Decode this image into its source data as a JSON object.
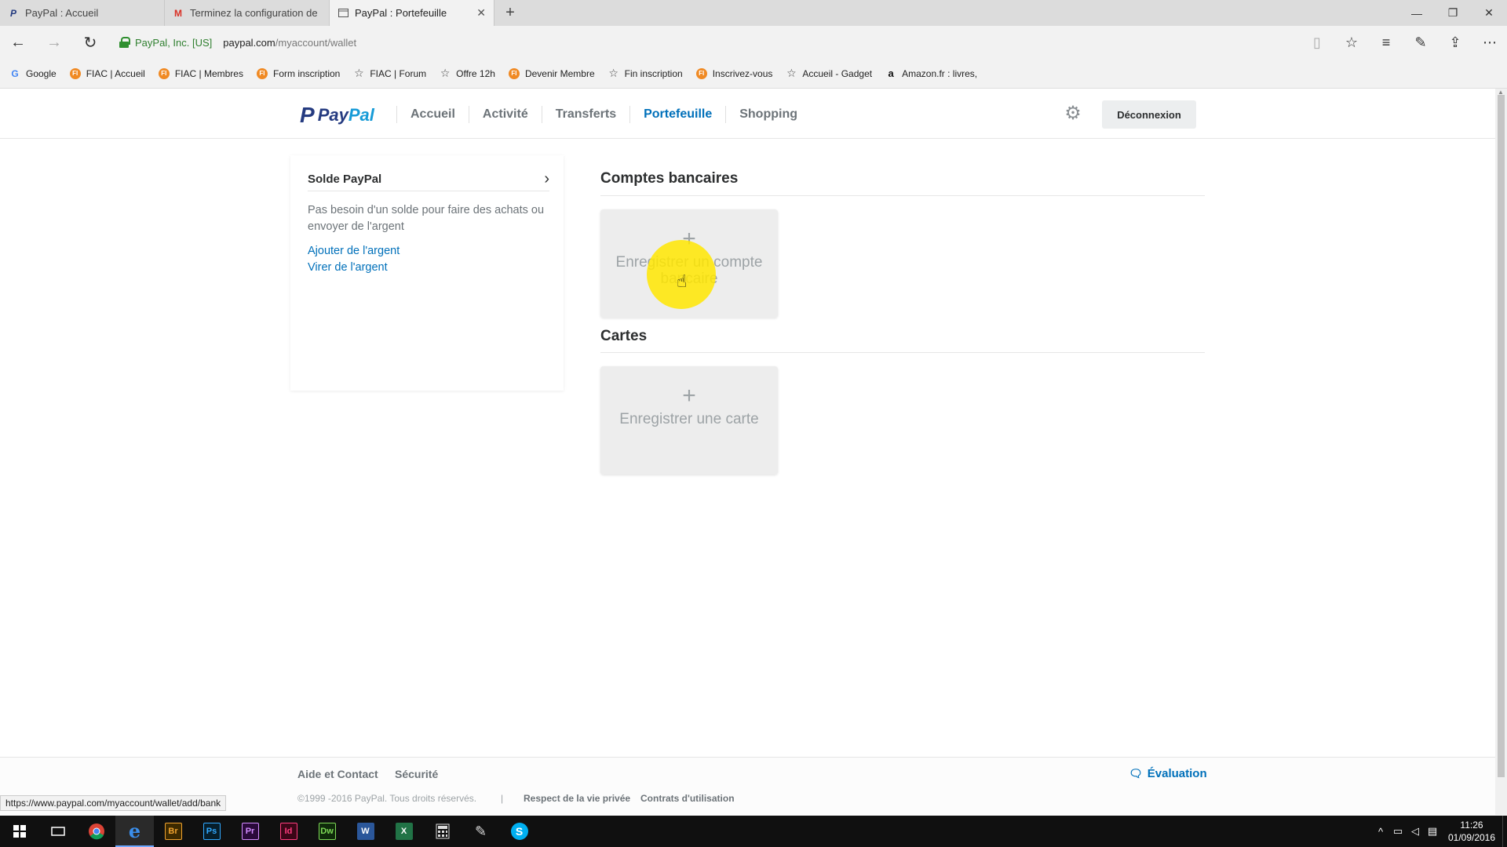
{
  "browser": {
    "tabs": [
      {
        "label": "PayPal : Accueil",
        "icon": "paypal-icon"
      },
      {
        "label": "Terminez la configuration de",
        "icon": "gmail-icon"
      },
      {
        "label": "PayPal : Portefeuille",
        "icon": "page-icon",
        "active": true
      }
    ],
    "cert_label": "PayPal, Inc. [US]",
    "url_host": "paypal.com",
    "url_path": "/myaccount/wallet",
    "favorites": [
      {
        "label": "Google",
        "icon": "google-icon"
      },
      {
        "label": "FIAC | Accueil",
        "icon": "fiac-icon"
      },
      {
        "label": "FIAC | Membres",
        "icon": "fiac-icon"
      },
      {
        "label": "Form inscription",
        "icon": "fiac-icon"
      },
      {
        "label": "FIAC | Forum",
        "icon": "star-icon"
      },
      {
        "label": "Offre 12h",
        "icon": "star-icon"
      },
      {
        "label": "Devenir Membre",
        "icon": "fiac-icon"
      },
      {
        "label": "Fin inscription",
        "icon": "star-icon"
      },
      {
        "label": "Inscrivez-vous",
        "icon": "fiac-icon"
      },
      {
        "label": "Accueil - Gadget",
        "icon": "star-icon"
      },
      {
        "label": "Amazon.fr : livres,",
        "icon": "amazon-icon"
      }
    ]
  },
  "header": {
    "logo_pay": "Pay",
    "logo_pal": "Pal",
    "nav": [
      "Accueil",
      "Activité",
      "Transferts",
      "Portefeuille",
      "Shopping"
    ],
    "active_nav": "Portefeuille",
    "logout_label": "Déconnexion"
  },
  "balance": {
    "title": "Solde PayPal",
    "description": "Pas besoin d'un solde pour faire des achats ou envoyer de l'argent",
    "add_link": "Ajouter de l'argent",
    "withdraw_link": "Virer de l'argent"
  },
  "banks": {
    "title": "Comptes bancaires",
    "add_label": "Enregistrer un compte bancaire"
  },
  "cards": {
    "title": "Cartes",
    "add_label": "Enregistrer une carte"
  },
  "footer": {
    "help": "Aide et Contact",
    "security": "Sécurité",
    "feedback": "Évaluation",
    "copyright": "©1999 -2016 PayPal. Tous droits réservés.",
    "separator": "|",
    "privacy": "Respect de la vie privée",
    "terms": "Contrats d'utilisation"
  },
  "status_url": "https://www.paypal.com/myaccount/wallet/add/bank",
  "taskbar": {
    "apps": [
      "start",
      "task-view",
      "chrome",
      "edge",
      "bridge",
      "photoshop",
      "premiere",
      "indesign",
      "dreamweaver",
      "word",
      "excel",
      "calculator",
      "paint",
      "skype"
    ],
    "badges": {
      "bridge": "Br",
      "photoshop": "Ps",
      "premiere": "Pr",
      "indesign": "Id",
      "dreamweaver": "Dw"
    },
    "time": "11:26",
    "date": "01/09/2016"
  }
}
